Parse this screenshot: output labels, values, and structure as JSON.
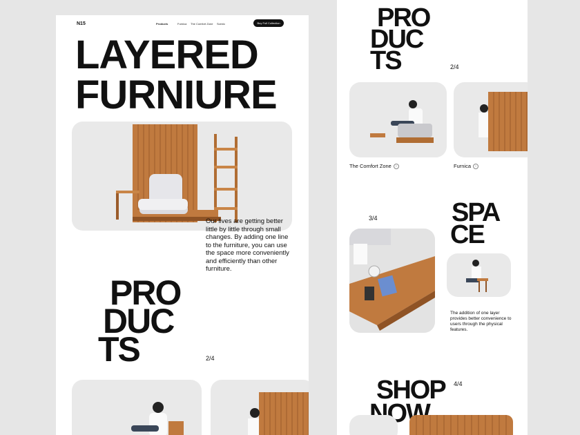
{
  "nav": {
    "logo": "N15",
    "links": [
      "Products",
      "Furnica",
      "The Comfort Zone",
      "Scenic"
    ],
    "cta": "Buy Full Collection"
  },
  "hero": {
    "line1": "LAYERED",
    "line2": "FURNIURE"
  },
  "intro_text": "Our lives are getting better little by little through small changes. By adding one line to the furniture, you can use the space more conveniently and efficiently than other furniture.",
  "products": {
    "lines": [
      "PRO",
      "DUC",
      "TS"
    ],
    "page": "2/4"
  },
  "cards": {
    "comfort_zone": "The Comfort Zone",
    "furnica": "Furnica",
    "arrow": "›"
  },
  "space": {
    "lines": [
      "SPA",
      "CE"
    ],
    "page": "3/4",
    "text": "The addition of one layer provides better convenience to users through the physical features."
  },
  "shop": {
    "lines": [
      "SHOP",
      "NOW"
    ],
    "page": "4/4"
  },
  "colors": {
    "wood": "#c07a3f",
    "wood_dark": "#8f5325",
    "cushion": "#e6e6ea",
    "card_bg": "#e9e9e9"
  }
}
